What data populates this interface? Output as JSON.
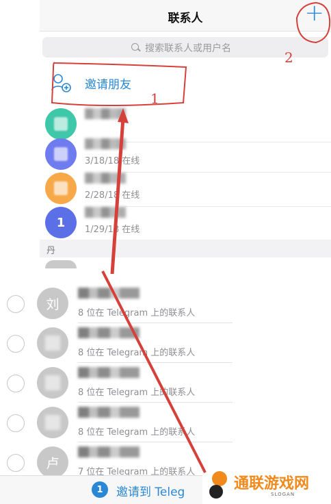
{
  "navbar": {
    "title": "联系人",
    "add_icon": "plus-icon"
  },
  "search": {
    "placeholder": "搜索联系人或用户名"
  },
  "invite": {
    "label": "邀请朋友",
    "icon": "add-contact-icon"
  },
  "contacts": [
    {
      "status": "",
      "color": "#3ec7a8"
    },
    {
      "status": "3/18/18 在线",
      "color": "#6f7cf0"
    },
    {
      "status": "2/28/18 在线",
      "color": "#f7a94a"
    },
    {
      "status": "1/29/18 在线",
      "color": "#5b6fe6",
      "initial": "1"
    }
  ],
  "section": {
    "label": "丹"
  },
  "invite_list": [
    {
      "initial": "刘",
      "subtitle": "8 位在 Telegram 上的联系人"
    },
    {
      "initial": "",
      "subtitle": "8 位在 Telegram 上的联系人"
    },
    {
      "initial": "",
      "subtitle": "8 位在 Telegram 上的联系人"
    },
    {
      "initial": "",
      "subtitle": "8 位在 Telegram 上的联系人"
    },
    {
      "initial": "卢",
      "subtitle": "7 位在 Telegram 上的联系人"
    }
  ],
  "toolbar": {
    "badge": "1",
    "label": "邀请到 Teleg"
  },
  "annotations": {
    "label_1": "1",
    "label_2": "2",
    "color": "#d6403a"
  },
  "watermark": {
    "text": "通联游戏网",
    "slogan": "SLOGAN"
  }
}
